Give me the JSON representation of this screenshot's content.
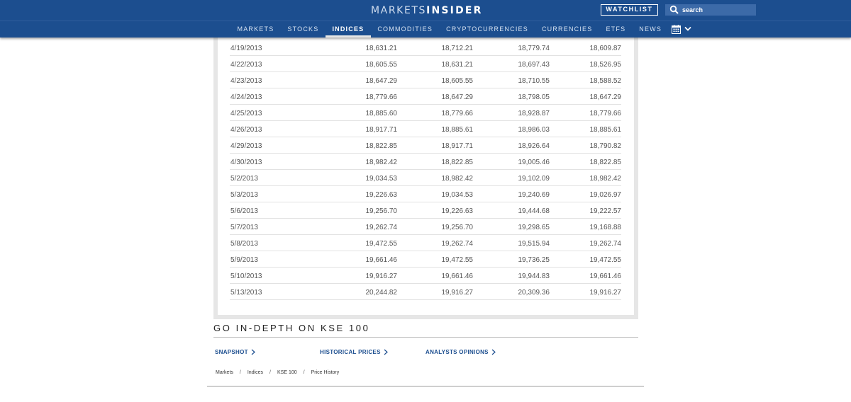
{
  "header": {
    "logo_left": "MARKETS",
    "logo_right": "INSIDER",
    "watchlist_label": "WATCHLIST",
    "search_placeholder": "search",
    "nav": [
      {
        "label": "MARKETS",
        "active": false
      },
      {
        "label": "STOCKS",
        "active": false
      },
      {
        "label": "INDICES",
        "active": true
      },
      {
        "label": "COMMODITIES",
        "active": false
      },
      {
        "label": "CRYPTOCURRENCIES",
        "active": false
      },
      {
        "label": "CURRENCIES",
        "active": false
      },
      {
        "label": "ETFS",
        "active": false
      },
      {
        "label": "NEWS",
        "active": false
      }
    ],
    "icons": {
      "search": "search-icon",
      "calendar": "calendar-icon",
      "chevron": "chevron-down-icon"
    }
  },
  "table": {
    "rows": [
      [
        "4/19/2013",
        "18,631.21",
        "18,712.21",
        "18,779.74",
        "18,609.87"
      ],
      [
        "4/22/2013",
        "18,605.55",
        "18,631.21",
        "18,697.43",
        "18,526.95"
      ],
      [
        "4/23/2013",
        "18,647.29",
        "18,605.55",
        "18,710.55",
        "18,588.52"
      ],
      [
        "4/24/2013",
        "18,779.66",
        "18,647.29",
        "18,798.05",
        "18,647.29"
      ],
      [
        "4/25/2013",
        "18,885.60",
        "18,779.66",
        "18,928.87",
        "18,779.66"
      ],
      [
        "4/26/2013",
        "18,917.71",
        "18,885.61",
        "18,986.03",
        "18,885.61"
      ],
      [
        "4/29/2013",
        "18,822.85",
        "18,917.71",
        "18,926.64",
        "18,790.82"
      ],
      [
        "4/30/2013",
        "18,982.42",
        "18,822.85",
        "19,005.46",
        "18,822.85"
      ],
      [
        "5/2/2013",
        "19,034.53",
        "18,982.42",
        "19,102.09",
        "18,982.42"
      ],
      [
        "5/3/2013",
        "19,226.63",
        "19,034.53",
        "19,240.69",
        "19,026.97"
      ],
      [
        "5/6/2013",
        "19,256.70",
        "19,226.63",
        "19,444.68",
        "19,222.57"
      ],
      [
        "5/7/2013",
        "19,262.74",
        "19,256.70",
        "19,298.65",
        "19,168.88"
      ],
      [
        "5/8/2013",
        "19,472.55",
        "19,262.74",
        "19,515.94",
        "19,262.74"
      ],
      [
        "5/9/2013",
        "19,661.46",
        "19,472.55",
        "19,736.25",
        "19,472.55"
      ],
      [
        "5/10/2013",
        "19,916.27",
        "19,661.46",
        "19,944.83",
        "19,661.46"
      ],
      [
        "5/13/2013",
        "20,244.82",
        "19,916.27",
        "20,309.36",
        "19,916.27"
      ]
    ]
  },
  "indepth": {
    "title": "GO IN-DEPTH ON KSE 100",
    "links": [
      "SNAPSHOT",
      "HISTORICAL PRICES",
      "ANALYSTS OPINIONS"
    ]
  },
  "breadcrumb": [
    "Markets",
    "Indices",
    "KSE 100",
    "Price History"
  ],
  "colors": {
    "brand": "#1c4e8f",
    "panel": "#e6e6e6",
    "link": "#1c4e8f"
  }
}
